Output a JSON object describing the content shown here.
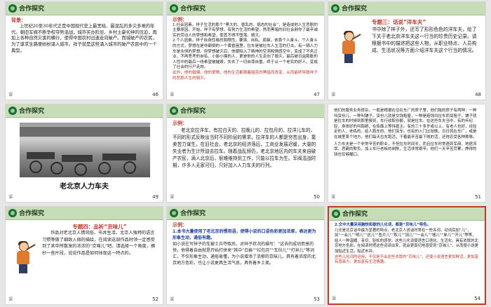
{
  "common": {
    "section_title": "合作探究",
    "page_mark": "课"
  },
  "slides": [
    {
      "page": "46",
      "label": "背景：",
      "text": "上世纪20至30年代正是中国现代史上最黑暗、最混乱的多灾多难的年代。朝旧军阀不断争权夺势混战，城市买办阶层、乡村土豪劣绅的压迫，再加上各种自然灾害的横行，使得中国农村迅速走向破产。而城破产的农民，为了谋求生路便纷纷涌入城市。祥子就是这些涌入城市的破产农民中的一个典型。"
    },
    {
      "page": "47",
      "label": "示例：",
      "p1": "1.社会因素。祥子生活的那个“黑大的、昏乱的、病态的社会”，是造成他人生悲剧的主要原因。开始，祥子有梦想，有努力生活的希望，然而黑暗的旧社会剥夺了最辛诚实的劳动人的梦想和希望，使其不得不堕落、毁灭。",
      "p2": "2.个人因素。祥子自身性格的局限性，要强、自私、孤僻，依靠个人奋斗、个人奋斗的方式，梦想在是非颠倒的一个黄昏困里，拉车是被拉车人生活的打击，有一辆人力车是永恒的梦想。但梦想破灭后，他便陷入了精神的空洞和情感空中，变成了不务正业、不再思考的自私，小偷小摸的人，更是他的人生走向了毁灭。最后被日益膨胀的人性中的最后一线希望被摧毁，失去了一切自尊自重。终于从一个老实的好人，变成了社会的行尸走肉。",
      "p3": "此外，他的婚姻、他的爱情，他的生活都随着困苦的黑暗而改变，从而最终导致祥子的悲剧人生的毁灭。"
    },
    {
      "page": "48",
      "topic": "专题三：话说“洋车夫”",
      "text": "书中除了祥子外，还写了形形色色的洋车夫，给了下关于老北京洋车夫这一行当的珍贵历史记录。请根据书中的描述把这些人物，从职业特点、人员构成、生活状况等方面介绍洋车夫这个行当的情况。"
    },
    {
      "page": "49",
      "caption": "老北京人力车夫"
    },
    {
      "page": "50",
      "label": "示例：",
      "text": "老北京拉洋车，有拉白天的、拉晚儿的、拉包月的，拉洋儿车的，不同的形式反映出当时不同阶层的需求。拉洋车的人都是穷苦出身，靠卖苦力谋生。在旧社会，老北京的经济落后，工商业发展迟缓，大量的失业者为生计所迫去拉车。随着战乱频仍，老北京地区内的车夫来自破产农民，满人北京后，很难维持到工作，只能以拉车为生。军阀混战时期，许多人无家可归，只好加入人力车夫的行列。"
    },
    {
      "page": "51",
      "text": "他们的服务业务很杂，一般是根据在住在车厂的房子里，他们租的房子有两种：一种叫赁份儿，一种叫铺子。赁份儿就是交钱租屋，一种是赔钱白拉车而赁租子。铺子就是拉车的时候到那里报到，车行收取份额，就是拉车。在这些车夫当中，有的年纪轻，身体好的叫跑趟，在街面上等待雇主。有的三十多岁或以上，有老人也好，经验足的人，老练的，给人跑车的，他们赁车。也有的入门比较晚，日日就在车厂，或是在城里某个地方。他们每天拉车跑活，干着最辛苦最下贱的活，还得忍受各种欺辱。",
      "text2": "人力车夫是一个非常辛苦的职业，不但拉车时间长，而且拉车时常遇到军阀、地痞流氓、恶霸的欺负，加上车行老板的剥削，生活非常艰辛。他们一天辛苦劳累，挣得的钱也仅够糊口。"
    },
    {
      "page": "52",
      "topic": "专题四：品析“京味儿”",
      "text": "作品对老北京人情风俗、市井生活、北京人独特的语言习惯等做了细致入微的描绘，在阅读这部作品时领一定感受到了其中所散发的浓浓的“京味儿”吧。请选择一个角度，摘抄一些片段，说说作品是如何体现这一特点的。"
    },
    {
      "page": "53",
      "label": "示例：",
      "p1": "1.本书大量使用了老北京的惯用语，使得小说的口语色彩更加浓厚，表达更为形象生动，通俗有趣。",
      "p2": "如小说在写祥子的车被士兵夺取后，对祥子状况的描写：“这去的成功而享的快，他得着自由就是开始打拼来”其中“白挨”“拉包月”“车份儿”“打井儿”等词汇，不仅形象生动，通俗易懂，为小说增添了浓郁的京味儿，具有着浓厚的北京地方色彩，也让小说更具生活气息，具有着乡土美。"
    },
    {
      "page": "54",
      "p1": "2.文中大量采用融快和歇的儿化词，都是“京味儿”特色。",
      "p2": "儿化是北京话中最为显著的特点，老北京人说话时常在一些名词、动词后加“儿”，如“一会儿”“明儿”“这儿”“鱼片儿”“取儿”“拐儿”“一会儿”“墙儿”“单儿”“开儿”等等，给人一种温暖、亲切、轻松的感觉。这些儿化词使语言口语化、生活化，具有浓厚的北京地方色彩。在阅读时把这些词读出来，就会更真切地感受到“京味儿”，从而使小说更加贴近生活，贴近市井。",
      "p3": "这些儿化词的运用，不仅是不出这些浓厚的“京味儿”，还使小说语言更加鲜活，更加富有感染力，更加富有生活情趣。"
    }
  ]
}
